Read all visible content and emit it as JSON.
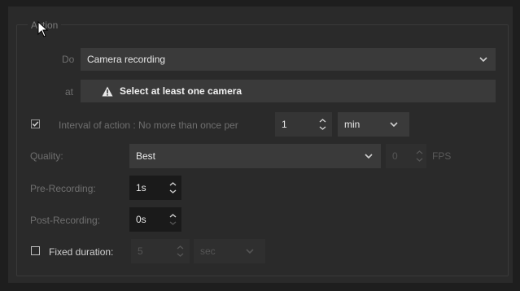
{
  "group_title": "Action",
  "do": {
    "label": "Do",
    "value": "Camera recording"
  },
  "at": {
    "label": "at",
    "warning": "Select at least one camera"
  },
  "interval": {
    "checked": true,
    "label": "Interval of action : No more than once per",
    "value": "1",
    "unit": "min"
  },
  "quality": {
    "label": "Quality:",
    "value": "Best",
    "fps_value": "0",
    "fps_unit": "FPS"
  },
  "pre_recording": {
    "label": "Pre-Recording:",
    "value": "1s"
  },
  "post_recording": {
    "label": "Post-Recording:",
    "value": "0s"
  },
  "fixed_duration": {
    "checked": false,
    "label": "Fixed duration:",
    "value": "5",
    "unit": "sec"
  },
  "colors": {
    "panel": "#2a2a2a",
    "field": "#3a3a3a",
    "label": "#6f6f6f",
    "warning": "#f0f0f0"
  }
}
